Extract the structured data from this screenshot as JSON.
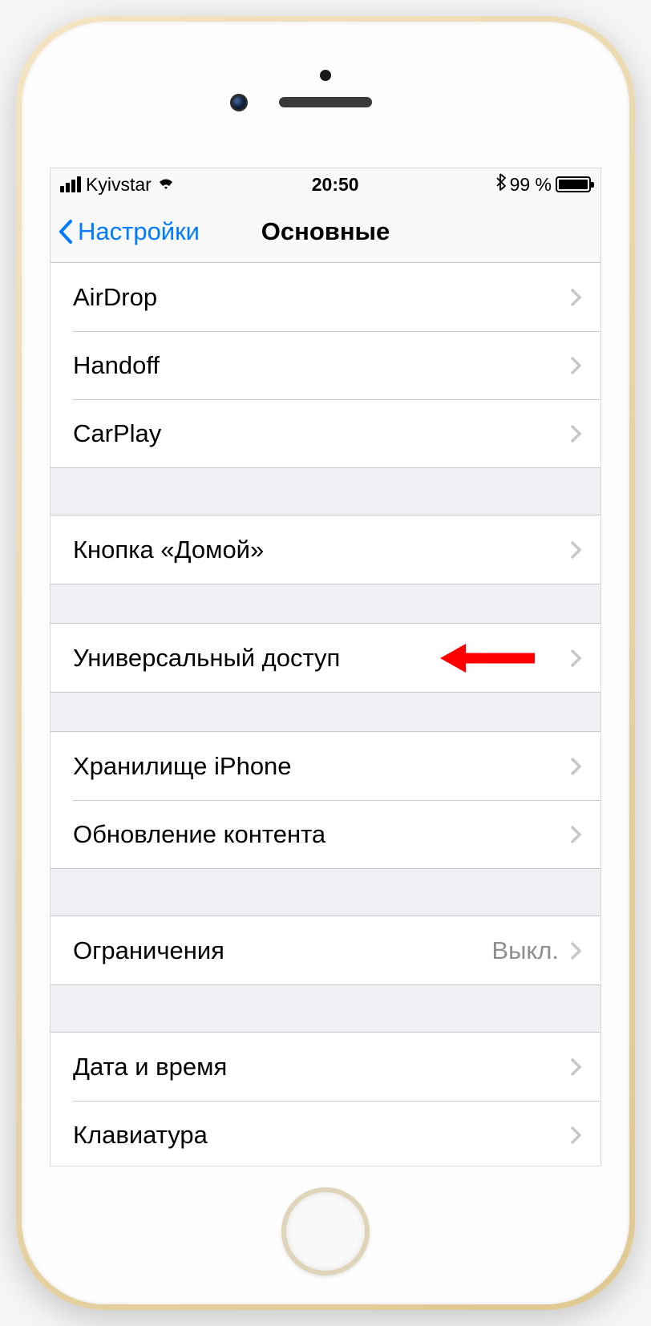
{
  "statusbar": {
    "carrier": "Kyivstar",
    "time": "20:50",
    "battery_pct": "99 %"
  },
  "nav": {
    "back": "Настройки",
    "title": "Основные"
  },
  "groups": [
    {
      "id": "g1",
      "cells": [
        {
          "label": "AirDrop"
        },
        {
          "label": "Handoff"
        },
        {
          "label": "CarPlay"
        }
      ]
    },
    {
      "id": "g2",
      "cells": [
        {
          "label": "Кнопка «Домой»"
        }
      ]
    },
    {
      "id": "g3",
      "cells": [
        {
          "label": "Универсальный доступ",
          "annotated": true
        }
      ]
    },
    {
      "id": "g4",
      "cells": [
        {
          "label": "Хранилище iPhone"
        },
        {
          "label": "Обновление контента"
        }
      ]
    },
    {
      "id": "g5",
      "cells": [
        {
          "label": "Ограничения",
          "value": "Выкл."
        }
      ]
    },
    {
      "id": "g6",
      "cells": [
        {
          "label": "Дата и время"
        },
        {
          "label": "Клавиатура"
        }
      ]
    }
  ],
  "annotation": {
    "color": "#ff0000"
  }
}
